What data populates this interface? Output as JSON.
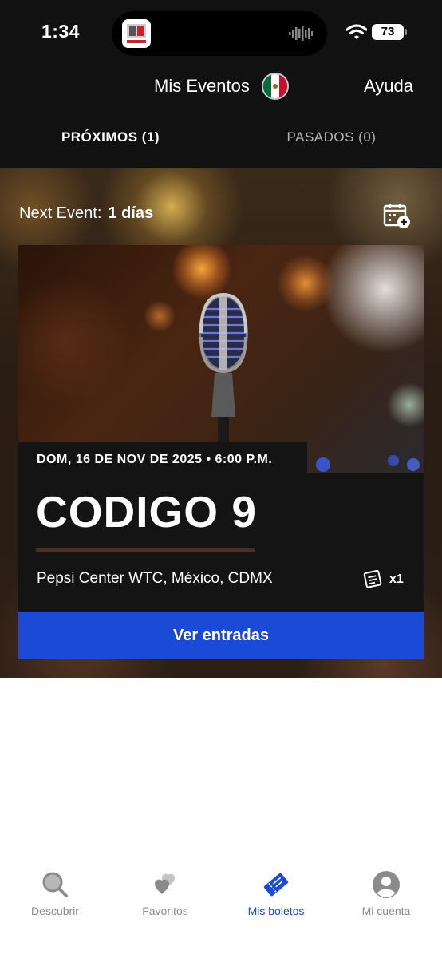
{
  "status_bar": {
    "time": "1:34",
    "battery": "73",
    "icons": [
      "app-thumbnail-icon",
      "audio-wave-icon",
      "wifi-icon",
      "battery-icon"
    ]
  },
  "header": {
    "title": "Mis Eventos",
    "flag_icon": "mexico-flag-icon",
    "help_label": "Ayuda"
  },
  "tabs": [
    {
      "label": "PRÓXIMOS (1)",
      "active": true
    },
    {
      "label": "PASADOS (0)",
      "active": false
    }
  ],
  "next_event": {
    "label": "Next Event:",
    "days": "1 días",
    "calendar_icon": "calendar-add-icon"
  },
  "event_card": {
    "date": "DOM, 16 DE NOV DE 2025 • 6:00 P.M.",
    "title": "CODIGO 9",
    "venue": "Pepsi Center WTC, México, CDMX",
    "ticket_icon": "ticket-icon",
    "ticket_count": "x1",
    "button_label": "Ver entradas",
    "image_icon": "microphone-image"
  },
  "bottom_nav": [
    {
      "label": "Descubrir",
      "icon": "search-icon",
      "active": false
    },
    {
      "label": "Favoritos",
      "icon": "hearts-icon",
      "active": false
    },
    {
      "label": "Mis boletos",
      "icon": "tickets-icon",
      "active": true
    },
    {
      "label": "Mi cuenta",
      "icon": "account-icon",
      "active": false
    }
  ],
  "colors": {
    "accent": "#1a4ad6",
    "dark_bg": "#111111",
    "card_bg": "#141414",
    "inactive_text": "#8a8a8a",
    "divider": "#4b2f26"
  }
}
